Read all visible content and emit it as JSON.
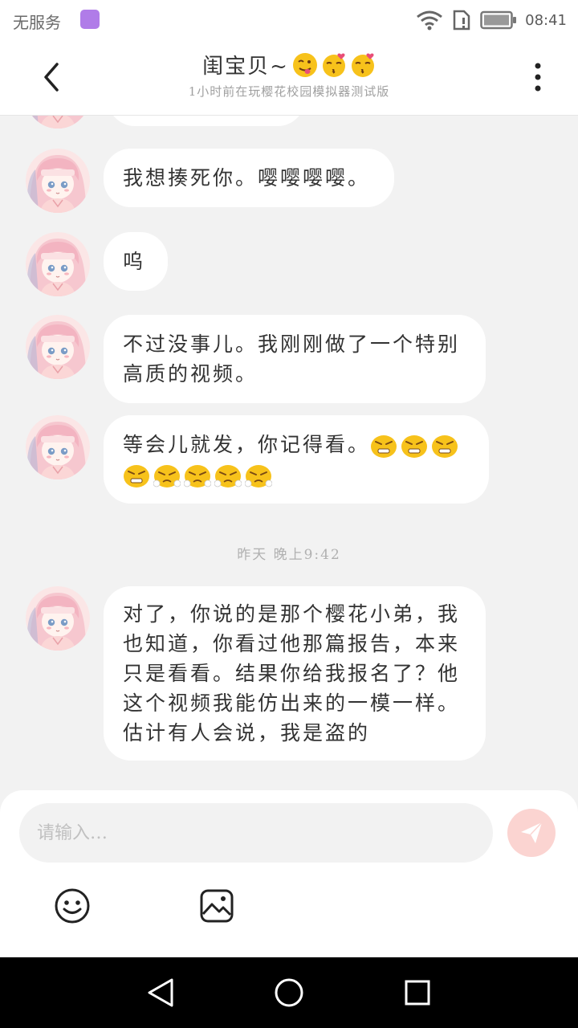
{
  "status_bar": {
    "carrier": "无服务",
    "time": "08:41"
  },
  "header": {
    "title": "闺宝贝~",
    "title_emojis": [
      "tongue-wink-emoji",
      "kiss-emoji",
      "kiss-emoji"
    ],
    "subtitle": "1小时前在玩樱花校园模拟器测试版"
  },
  "messages": [
    {
      "text": "我想揍死你。嘤嘤嘤嘤。"
    },
    {
      "text": "呜"
    },
    {
      "text": "不过没事儿。我刚刚做了一个特别高质的视频。"
    },
    {
      "text": "等会儿就发，你记得看。",
      "emojis": [
        "angry-emoji",
        "angry-emoji",
        "angry-emoji",
        "angry-emoji",
        "huff-emoji",
        "huff-emoji",
        "huff-emoji",
        "huff-emoji",
        "huff-emoji"
      ]
    },
    {
      "text": "对了，你说的是那个樱花小弟，我也知道，你看过他那篇报告，本来只是看看。结果你给我报名了？他这个视频我能仿出来的一模一样。估计有人会说，我是盗的"
    }
  ],
  "timestamp": "昨天 晚上9:42",
  "composer": {
    "placeholder": "请输入…",
    "value": ""
  },
  "colors": {
    "accent": "#f4796b",
    "send_bg": "#fbd4d1",
    "bubble": "#ffffff",
    "background": "#f2f2f2"
  },
  "icons": {
    "back": "chevron-left-icon",
    "more": "more-vertical-icon",
    "send": "paper-plane-icon",
    "emoji": "smiley-icon",
    "image": "image-icon"
  }
}
